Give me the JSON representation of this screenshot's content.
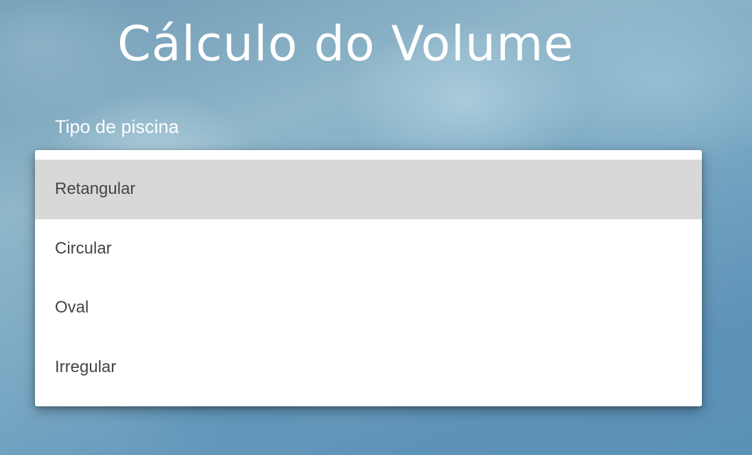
{
  "page": {
    "title": "Cálculo do Volume"
  },
  "form": {
    "pool_type_label": "Tipo de piscina",
    "pool_type_options": [
      {
        "label": "Retangular",
        "selected": true
      },
      {
        "label": "Circular",
        "selected": false
      },
      {
        "label": "Oval",
        "selected": false
      },
      {
        "label": "Irregular",
        "selected": false
      }
    ]
  },
  "colors": {
    "background": "#6f9ab5",
    "title_text": "#ffffff",
    "option_text": "#444444",
    "selected_option_bg": "#d8d8d8",
    "menu_bg": "#ffffff"
  }
}
